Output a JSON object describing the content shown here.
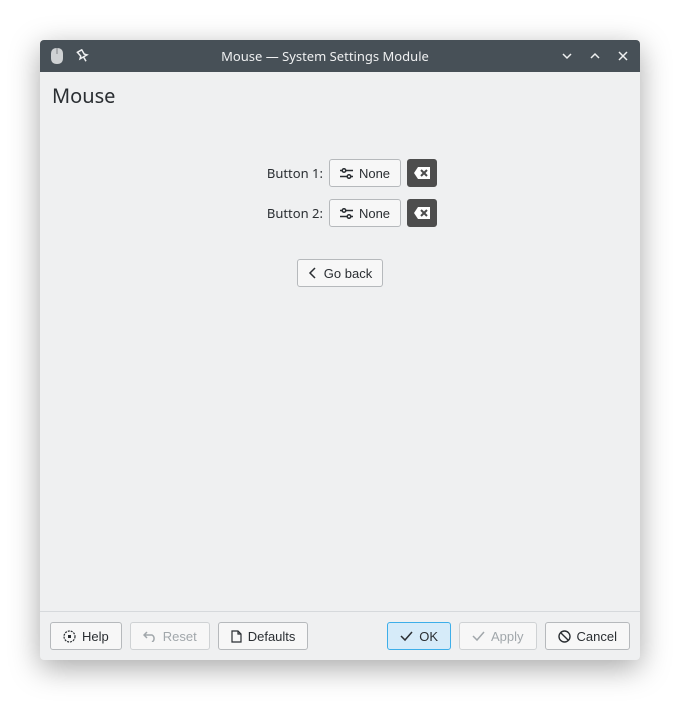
{
  "titlebar": {
    "title": "Mouse — System Settings Module"
  },
  "header": {
    "title": "Mouse"
  },
  "form": {
    "button1_label": "Button 1:",
    "button1_value": "None",
    "button2_label": "Button 2:",
    "button2_value": "None"
  },
  "goback": "Go back",
  "buttons": {
    "help": "Help",
    "reset": "Reset",
    "defaults": "Defaults",
    "ok": "OK",
    "apply": "Apply",
    "cancel": "Cancel"
  }
}
